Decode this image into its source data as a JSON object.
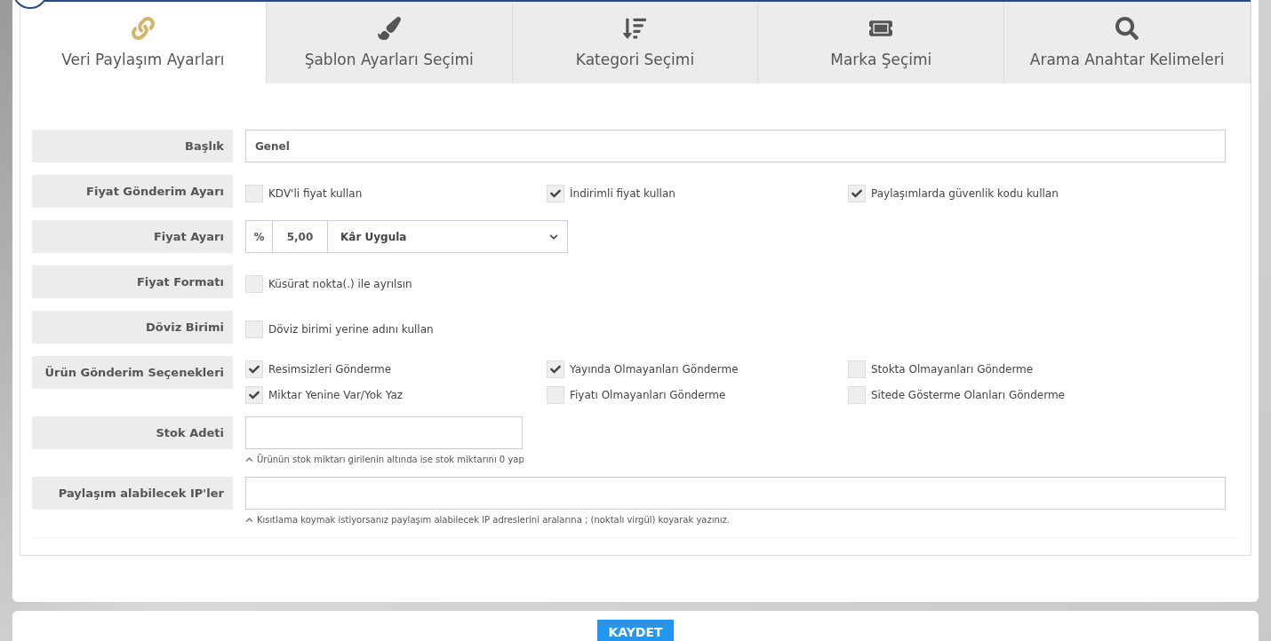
{
  "tabs": [
    {
      "label": "Veri Paylaşım Ayarları",
      "selected": true
    },
    {
      "label": "Şablon Ayarları Seçimi",
      "selected": false
    },
    {
      "label": "Kategori Seçimi",
      "selected": false
    },
    {
      "label": "Marka Şeçimi",
      "selected": false
    },
    {
      "label": "Arama Anahtar Kelimeleri",
      "selected": false
    }
  ],
  "rows": [
    {
      "kind": "field",
      "label": "Başlık",
      "value": "Genel"
    },
    {
      "kind": "checks",
      "label": "Fiyat Gönderim Ayarı",
      "options": [
        {
          "label": "KDV'li fiyat kullan",
          "checked": false
        },
        {
          "label": "İndirimli fiyat kullan",
          "checked": true
        },
        {
          "label": "Paylaşımlarda güvenlik kodu kullan",
          "checked": true
        }
      ]
    },
    {
      "kind": "price",
      "label": "Fiyat Ayarı",
      "prefix": "%",
      "value": "5,00",
      "select": "Kâr Uygula"
    },
    {
      "kind": "checks",
      "label": "Fiyat Formatı",
      "options": [
        {
          "label": "Küsürat nokta(.) ile ayrılsın",
          "checked": false
        }
      ]
    },
    {
      "kind": "checks",
      "label": "Döviz Birimi",
      "options": [
        {
          "label": "Döviz birimi yerine adını kullan",
          "checked": false
        }
      ]
    },
    {
      "kind": "checks",
      "label": "Ürün Gönderim Seçenekleri",
      "options": [
        {
          "label": "Resimsizleri Gönderme",
          "checked": true
        },
        {
          "label": "Yayında Olmayanları Gönderme",
          "checked": true
        },
        {
          "label": "Stokta Olmayanları Gönderme",
          "checked": false
        },
        {
          "label": "Miktar Yenine Var/Yok Yaz",
          "checked": true
        },
        {
          "label": "Fiyatı Olmayanları Gönderme",
          "checked": false
        },
        {
          "label": "Sitede Gösterme Olanları Gönderme",
          "checked": false
        }
      ]
    },
    {
      "kind": "short-field",
      "label": "Stok Adeti",
      "hint": "Ürünün stok miktarı girilenin altında ise stok miktarını 0 yap"
    },
    {
      "kind": "field",
      "label": "Paylaşım alabilecek IP'ler",
      "hint": "Kısıtlama koymak istiyorsanız paylaşım alabilecek IP adreslerini aralarına ; (noktalı virgül) koyarak yazınız."
    }
  ],
  "save_button": "KAYDET"
}
